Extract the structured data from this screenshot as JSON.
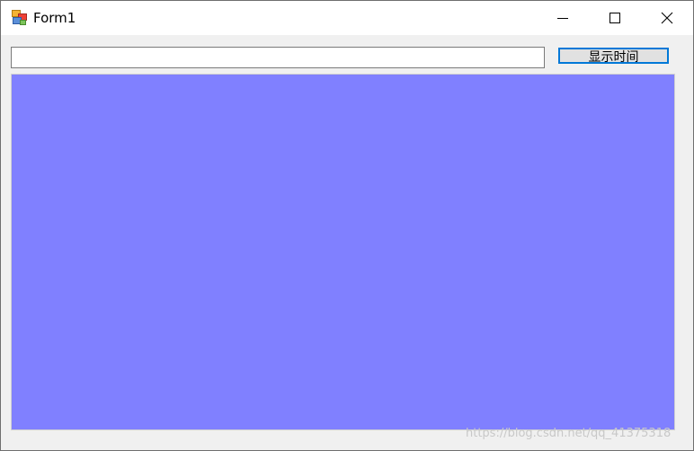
{
  "window": {
    "title": "Form1"
  },
  "titlebar": {
    "icons": {
      "app": "app-icon",
      "minimize": "minimize-icon",
      "maximize": "maximize-icon",
      "close": "close-icon"
    }
  },
  "form": {
    "textbox": {
      "value": "",
      "placeholder": ""
    },
    "button": {
      "label": "显示时间"
    },
    "panel": {
      "color": "#8080ff"
    }
  },
  "watermark": {
    "text": "https://blog.csdn.net/qq_41375318"
  },
  "colors": {
    "panel_fill": "#8080ff",
    "focus_border": "#0078d7"
  }
}
